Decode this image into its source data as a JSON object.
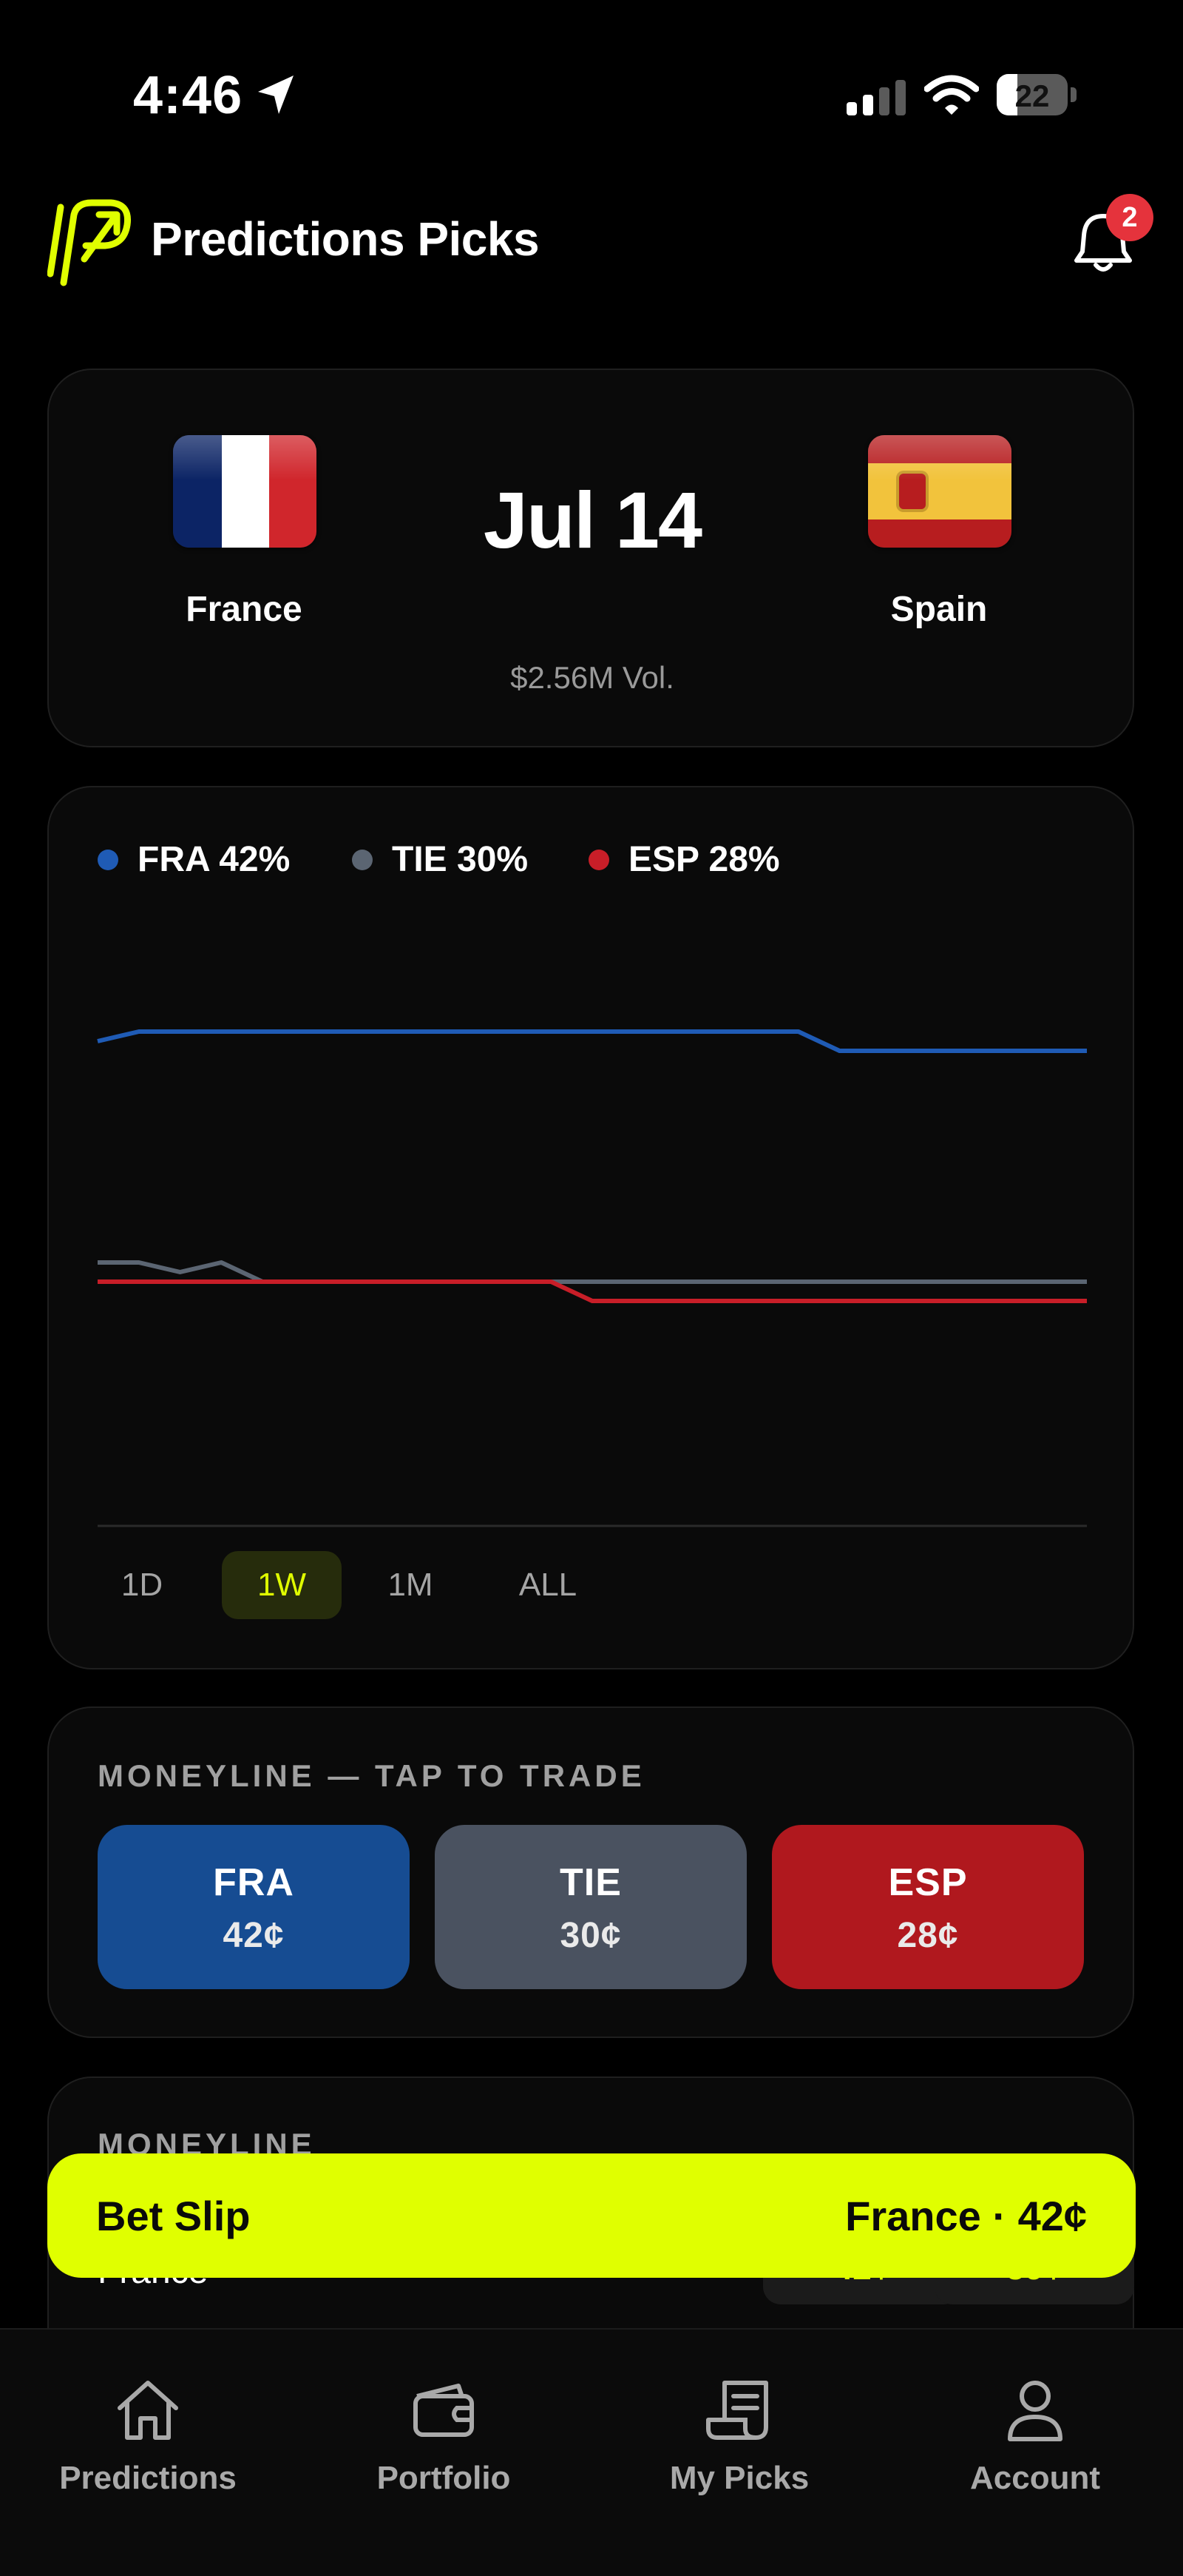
{
  "status_bar": {
    "time": "4:46",
    "battery": "22"
  },
  "header": {
    "title": "Predictions Picks",
    "notification_count": "2"
  },
  "match": {
    "date": "Jul 14",
    "volume": "$2.56M Vol.",
    "home_team": "France",
    "away_team": "Spain"
  },
  "chart": {
    "range_tabs": [
      "1D",
      "1W",
      "1M",
      "ALL"
    ],
    "active_range": "1W"
  },
  "chart_data": {
    "type": "line",
    "title": "",
    "xlabel": "",
    "ylabel": "",
    "legend_position": "top-left",
    "grid": false,
    "ylim": [
      0,
      100
    ],
    "x": [
      0,
      1,
      2,
      3,
      4,
      5,
      6,
      7,
      8,
      9,
      10,
      11,
      12,
      13,
      14,
      15,
      16,
      17,
      18,
      19,
      20,
      21,
      22,
      23,
      24
    ],
    "series": [
      {
        "name": "FRA",
        "label": "FRA 42%",
        "color": "#1f5bb5",
        "values": [
          42.5,
          43,
          43,
          43,
          43,
          43,
          43,
          43,
          43,
          43,
          43,
          43,
          43,
          43,
          43,
          43,
          43,
          43,
          42,
          42,
          42,
          42,
          42,
          42,
          42
        ]
      },
      {
        "name": "TIE",
        "label": "TIE 30%",
        "color": "#5b6572",
        "values": [
          31,
          31,
          30.5,
          31,
          30,
          30,
          30,
          30,
          30,
          30,
          30,
          30,
          30,
          30,
          30,
          30,
          30,
          30,
          30,
          30,
          30,
          30,
          30,
          30,
          30
        ]
      },
      {
        "name": "ESP",
        "label": "ESP 28%",
        "color": "#c81e28",
        "values": [
          30,
          30,
          30,
          30,
          30,
          30,
          30,
          30,
          30,
          30,
          30,
          30,
          29,
          29,
          29,
          29,
          29,
          29,
          29,
          29,
          29,
          29,
          29,
          29,
          29
        ]
      }
    ]
  },
  "moneyline": {
    "title": "MONEYLINE — TAP TO TRADE",
    "options": [
      {
        "code": "FRA",
        "price": "42¢",
        "color": "#164c92"
      },
      {
        "code": "TIE",
        "price": "30¢",
        "color": "#4a5260"
      },
      {
        "code": "ESP",
        "price": "28¢",
        "color": "#b0181e"
      }
    ]
  },
  "lower_card": {
    "title": "MONEYLINE",
    "team": "France",
    "price_1": "42¢",
    "price_2": "59¢"
  },
  "bet_slip": {
    "title": "Bet Slip",
    "selection": "France · 42¢"
  },
  "tab_bar": {
    "items": [
      {
        "label": "Predictions",
        "icon": "home-icon"
      },
      {
        "label": "Portfolio",
        "icon": "wallet-icon"
      },
      {
        "label": "My Picks",
        "icon": "receipt-icon"
      },
      {
        "label": "Account",
        "icon": "person-icon"
      }
    ]
  },
  "colors": {
    "accent": "#e0ff00",
    "background": "#000000",
    "card": "#0a0a0a"
  }
}
